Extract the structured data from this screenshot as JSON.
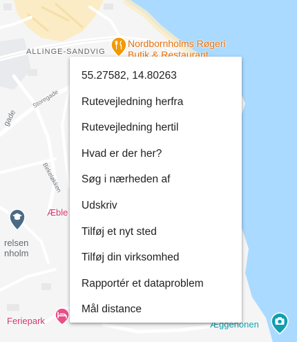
{
  "map": {
    "town_label": "ALLINGE-SANDVIG",
    "restaurant_name": "Nordbornholms Røgeri Butik & Restaurant",
    "restaurant_line1": "Nordbornholms Røgeri",
    "restaurant_line2": "Butik & Restaurant",
    "road_storegade": "Storegade",
    "road_storegade_partial": "gade",
    "road_birkelokken": "Birkeløkken",
    "poi_aeble_partial": "Æble",
    "area_partial_line1": "relsen",
    "area_partial_line2": "nholm",
    "poi_feriepark": "Feriepark",
    "poi_aeggenonen": "Æggenonen",
    "icons": {
      "restaurant": "fork-knife-icon",
      "school": "graduation-cap-icon",
      "lodging": "bed-icon",
      "camera": "camera-icon"
    },
    "colors": {
      "land": "#f5f5f5",
      "water": "#aadaff",
      "sand": "#fbecc5",
      "road": "#ffffff",
      "restaurant_pin": "#f29900",
      "lodging_pin": "#e94e89",
      "poi_pin": "#129eaf",
      "school_pin": "#4b6a84"
    }
  },
  "context_menu": {
    "items": [
      {
        "label": "55.27582, 14.80263"
      },
      {
        "label": "Rutevejledning herfra"
      },
      {
        "label": "Rutevejledning hertil"
      },
      {
        "label": "Hvad er der her?"
      },
      {
        "label": "Søg i nærheden af"
      },
      {
        "label": "Udskriv"
      },
      {
        "label": "Tilføj et nyt sted"
      },
      {
        "label": "Tilføj din virksomhed"
      },
      {
        "label": "Rapportér et dataproblem"
      },
      {
        "label": "Mål distance"
      }
    ]
  }
}
